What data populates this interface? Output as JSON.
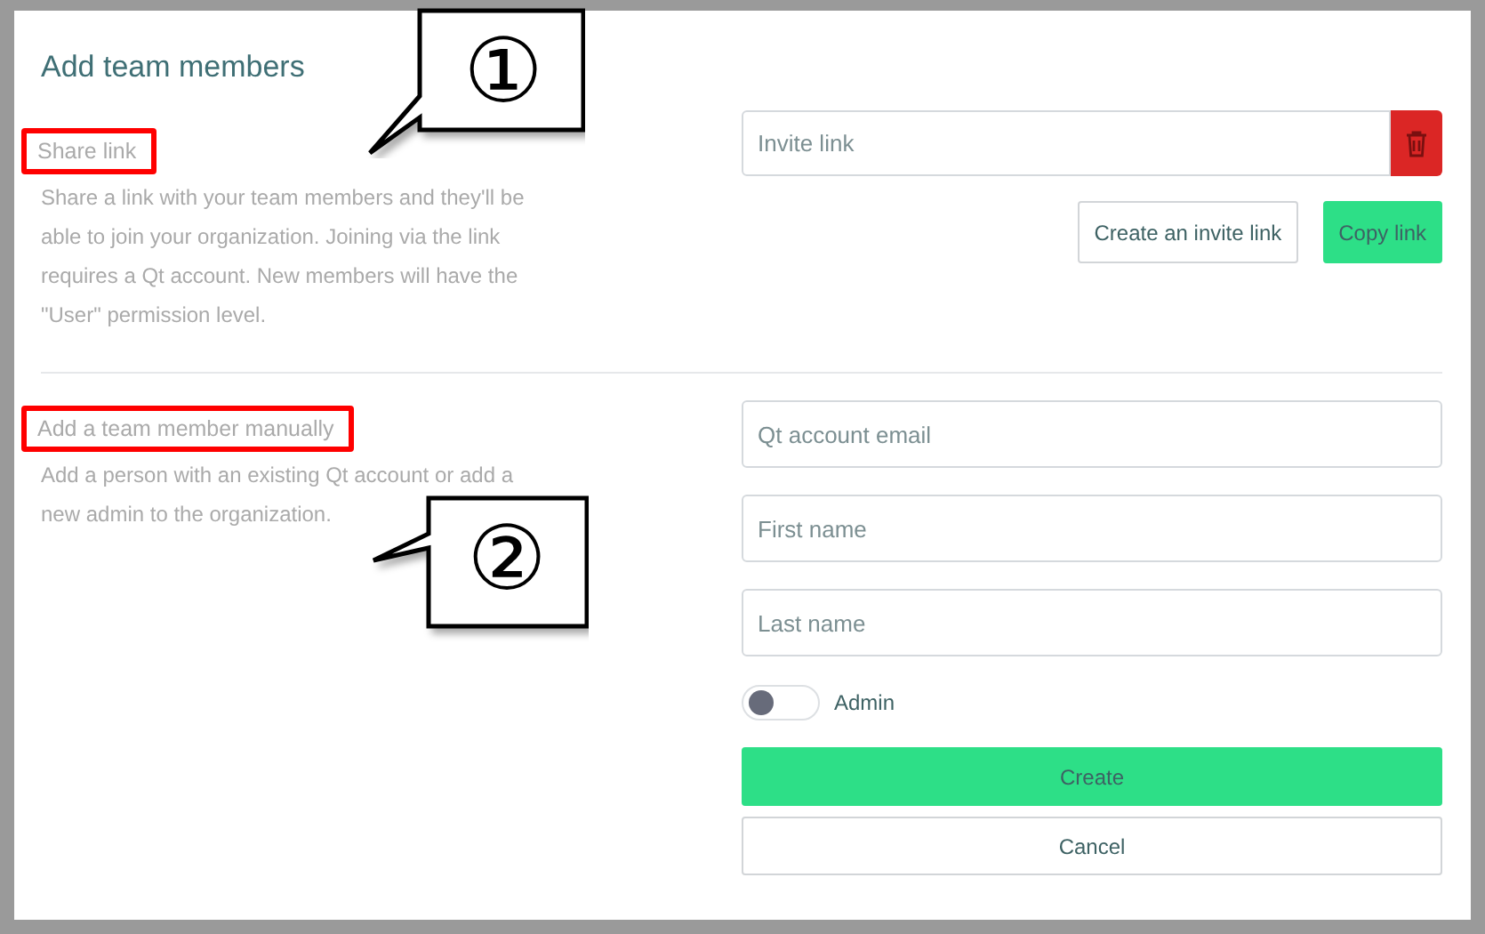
{
  "dialog": {
    "title": "Add team members"
  },
  "share": {
    "heading": "Share link",
    "highlighted": true,
    "description": "Share a link with your team members and they'll be able to join your organization. Joining via the link requires a Qt account. New members will have the \"User\" permission level.",
    "link_field": {
      "placeholder": "Invite link"
    },
    "buttons": [
      {
        "label": "Create an invite link",
        "kind": "outline"
      },
      {
        "label": "Copy link",
        "kind": "primary"
      }
    ]
  },
  "manual": {
    "heading": "Add a team member manually",
    "highlighted": true,
    "description": "Add a person with an existing Qt account or add a new admin to the organization.",
    "fields": [
      {
        "placeholder": "Qt account email"
      },
      {
        "placeholder": "First name"
      },
      {
        "placeholder": "Last name"
      }
    ],
    "admin_toggle": {
      "label": "Admin",
      "on": false
    },
    "buttons": [
      {
        "label": "Create",
        "kind": "primary"
      },
      {
        "label": "Cancel",
        "kind": "outline"
      }
    ]
  },
  "callouts": [
    {
      "label": "①"
    },
    {
      "label": "②"
    }
  ]
}
